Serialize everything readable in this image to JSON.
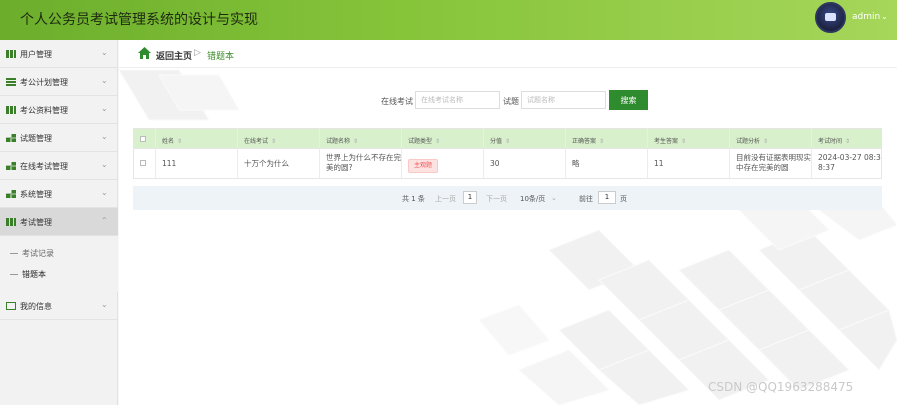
{
  "header": {
    "title": "个人公务员考试管理系统的设计与实现",
    "username": "admin",
    "caret": "⌄"
  },
  "sidebar": {
    "items": [
      {
        "label": "用户管理"
      },
      {
        "label": "考公计划管理"
      },
      {
        "label": "考公资料管理"
      },
      {
        "label": "试题管理"
      },
      {
        "label": "在线考试管理"
      },
      {
        "label": "系统管理"
      },
      {
        "label": "考试管理"
      },
      {
        "label": "我的信息"
      }
    ],
    "submenu": [
      {
        "label": "考试记录"
      },
      {
        "label": "错题本"
      }
    ],
    "chevron": "⌄",
    "chevron_up": "⌃"
  },
  "breadcrumb": {
    "home": "返回主页",
    "separator": "▷",
    "current": "错题本"
  },
  "search": {
    "exam_label": "在线考试",
    "exam_placeholder": "在线考试名称",
    "question_label": "试题",
    "question_placeholder": "试题名称",
    "button": "搜索"
  },
  "table": {
    "sort_glyph": "⇕",
    "columns": [
      "姓名",
      "在线考试",
      "试题名称",
      "试题类型",
      "分值",
      "正确答案",
      "考生答案",
      "试题分析",
      "考试时间"
    ],
    "rows": [
      {
        "name": "111",
        "exam": "十万个为什么",
        "question": "世界上为什么不存在完美的圆?",
        "type": "主观题",
        "score": "30",
        "correct_answer": "略",
        "student_answer": "11",
        "analysis": "目前没有证据表明现实中存在完美的圆",
        "time": "2024-03-27 08:38:37"
      }
    ]
  },
  "pagination": {
    "total": "共 1 条",
    "prev": "上一页",
    "page": "1",
    "next": "下一页",
    "page_size": "10条/页",
    "size_caret": "⌄",
    "goto": "前往",
    "goto_value": "1",
    "page_unit": "页"
  },
  "watermark": "CSDN @QQ1963288475",
  "colors": {
    "accent": "#2e8b2e",
    "header_start": "#6cae2c",
    "header_end": "#a6d65a",
    "table_header": "#d8f0cc"
  }
}
